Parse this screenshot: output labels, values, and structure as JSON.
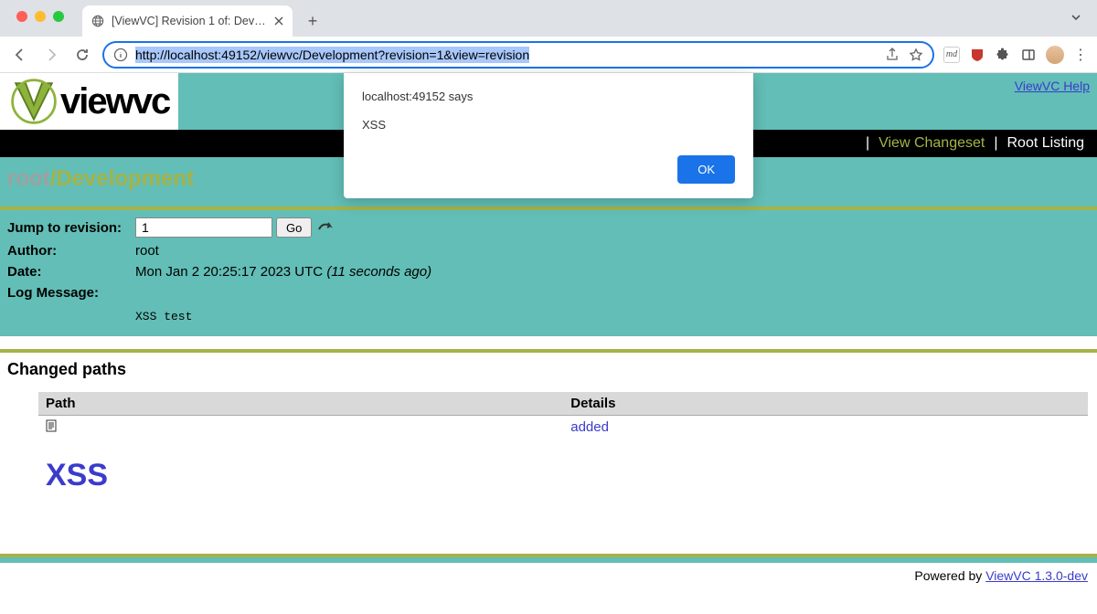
{
  "browser": {
    "tab_title": "[ViewVC] Revision 1 of: Develo...",
    "url": "http://localhost:49152/viewvc/Development?revision=1&view=revision"
  },
  "alert": {
    "title": "localhost:49152 says",
    "message": "XSS",
    "ok": "OK"
  },
  "header": {
    "logo_text": "viewvc",
    "help": "ViewVC Help"
  },
  "navbar": {
    "view_changeset": "View Changeset",
    "root_listing": "Root Listing"
  },
  "breadcrumb": {
    "root": "root",
    "slash": "/",
    "current": "Development"
  },
  "revision": {
    "jump_label": "Jump to revision:",
    "value": "1",
    "go": "Go",
    "author_label": "Author:",
    "author": "root",
    "date_label": "Date:",
    "date": "Mon Jan 2 20:25:17 2023 UTC",
    "date_rel": "(11 seconds ago)",
    "log_label": "Log Message:",
    "log_message": "XSS test"
  },
  "changed": {
    "heading": "Changed paths",
    "col_path": "Path",
    "col_details": "Details",
    "row_xss": "XSS",
    "row_details": "added"
  },
  "footer": {
    "powered": "Powered by ",
    "version": "ViewVC 1.3.0-dev"
  }
}
